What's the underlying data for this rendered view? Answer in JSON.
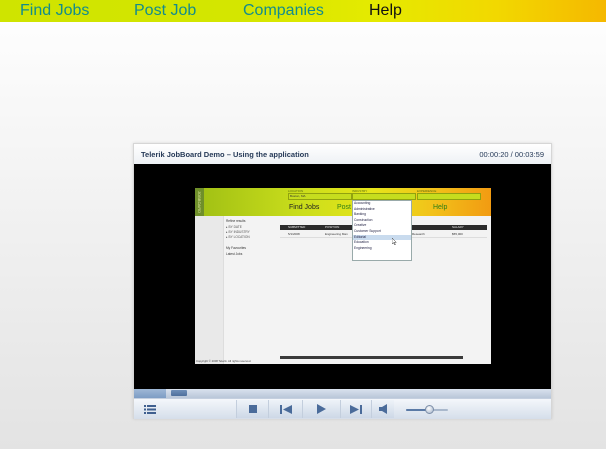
{
  "nav": {
    "find_jobs": "Find Jobs",
    "post_job": "Post Job",
    "companies": "Companies",
    "help": "Help"
  },
  "player": {
    "title": "Telerik JobBoard Demo – Using the application",
    "time": "00:00:20 / 00:03:59",
    "progress_fraction": 0.077,
    "volume_fraction": 0.55,
    "icons": {
      "playlist": "playlist-icon",
      "stop": "stop-icon",
      "previous": "previous-icon",
      "play": "play-icon",
      "next": "next-icon",
      "volume": "volume-icon"
    }
  },
  "recorded_screen": {
    "logo": "JOBBOARD",
    "filters": [
      "LOCATION",
      "INDUSTRY",
      "EXPERIENCE"
    ],
    "location_value": "Boston, MA",
    "nav": [
      "Find Jobs",
      "Post",
      "Help"
    ],
    "sidebar": [
      "Refine results",
      "▸ BY DATE",
      "▸ BY INDUSTRY",
      "▸ BY LOCATION",
      "",
      "My Favourites",
      "Latest Jobs"
    ],
    "table_headers": [
      "SUBMITTED",
      "POSITION",
      "",
      "SALARY"
    ],
    "row": [
      "5/1/2008",
      "Engineering Man",
      "Research",
      "$55,000"
    ],
    "dropdown": [
      "Accounting",
      "Administrative",
      "Banking",
      "Construction",
      "Creative",
      "Customer Support",
      "Editorial",
      "Education",
      "Engineering"
    ],
    "dropdown_highlight": 6,
    "footer": "Copyright © 2008 Telerik. All rights reserved."
  },
  "colors": {
    "nav_link": "#138c8c",
    "nav_help": "#111111",
    "player_title": "#263a58"
  }
}
